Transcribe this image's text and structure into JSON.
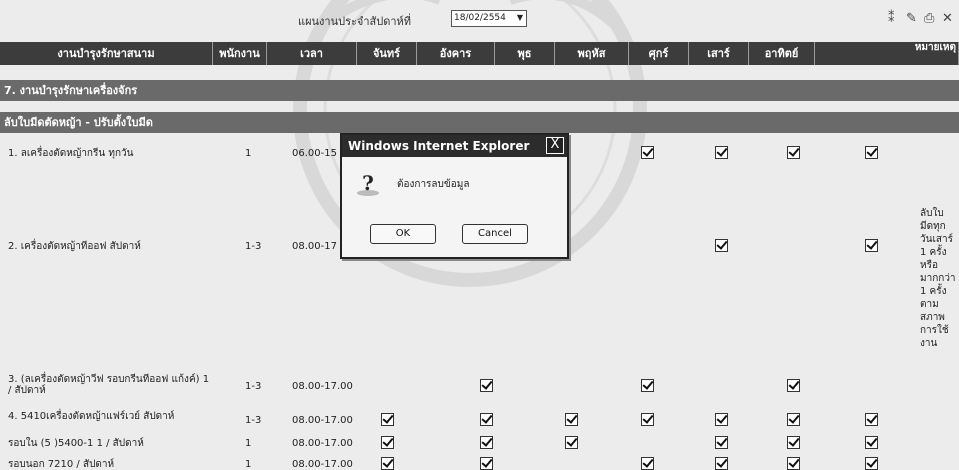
{
  "toolbar": {
    "plan_label": "แผนงานประจำสัปดาห์ที่",
    "week_value": "18/02/2554",
    "icons": [
      "grid-icon",
      "edit-icon",
      "print-icon",
      "close-icon"
    ]
  },
  "table": {
    "headers": [
      "งานบำรุงรักษาสนาม",
      "พนักงาน",
      "เวลา",
      "จันทร์",
      "อังคาร",
      "พุธ",
      "พฤหัส",
      "ศุกร์",
      "เสาร์",
      "อาทิตย์",
      "หมายเหตุ"
    ],
    "section1": "7. งานบำรุงรักษาเครื่องจักร",
    "section2": "ลับใบมีดตัดหญ้า - ปรับตั้งใบมีด",
    "rows": [
      {
        "name": "1. ลเครื่องตัดหญ้ากรีน   ทุกวัน",
        "staff": "1",
        "time": "06.00-15",
        "checks": [
          false,
          false,
          false,
          true,
          true,
          true,
          true
        ]
      },
      {
        "name": "2. เครื่องตัดหญ้าทีออฟ      สัปดาห์",
        "staff": "1-3",
        "time": "08.00-17",
        "checks": [
          false,
          false,
          false,
          false,
          true,
          false,
          true
        ]
      },
      {
        "name": "3. (ลเครื่องตัดหญ้าวีฟ รอบกรีนทีออฟ แก้งค์) 1 / สัปดาห์",
        "staff": "1-3",
        "time": "08.00-17.00",
        "checks": [
          false,
          true,
          false,
          true,
          false,
          true,
          false
        ]
      },
      {
        "name": "4. 5410เครื่องตัดหญ้าแฟร์เวย์ สัปดาห์",
        "staff": "1-3",
        "time": "08.00-17.00",
        "checks": [
          true,
          true,
          true,
          true,
          true,
          true,
          true
        ]
      },
      {
        "name": "รอบใน (5 )5400-1 1 /          สัปดาห์",
        "staff": "1",
        "time": "08.00-17.00",
        "checks": [
          true,
          true,
          true,
          false,
          true,
          true,
          true
        ]
      },
      {
        "name": "รอบนอก 7210 / สัปดาห์",
        "staff": "1",
        "time": "08.00-17.00",
        "checks": [
          true,
          true,
          false,
          true,
          true,
          true,
          true
        ]
      }
    ],
    "note": "ลับใบ มีดทุก วันเสาร์ 1 ครั้ง หรือ มากกว่า 1 ครั้ง ตาม สภาพ การใช้ งาน"
  },
  "dialog": {
    "title": "Windows Internet Explorer",
    "close": "X",
    "message": "ต้องการลบข้อมูล",
    "ok_label": "OK",
    "cancel_label": "Cancel",
    "icon": "question-icon"
  }
}
